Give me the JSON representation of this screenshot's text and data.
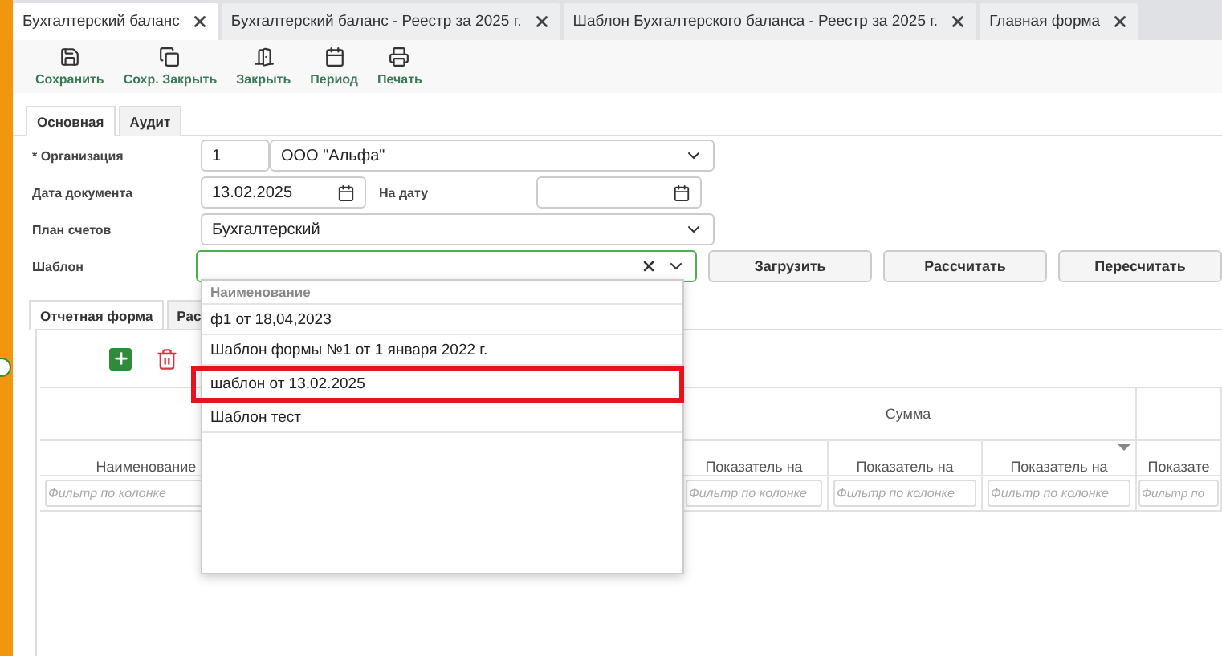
{
  "tabs": [
    {
      "label": "Бухгалтерский баланс",
      "selected": true
    },
    {
      "label": "Бухгалтерский баланс - Реестр за 2025 г.",
      "selected": false
    },
    {
      "label": "Шаблон Бухгалтерского баланса - Реестр за 2025 г.",
      "selected": false
    },
    {
      "label": "Главная форма",
      "selected": false
    }
  ],
  "toolbar": [
    {
      "kind": "save",
      "label": "Сохранить"
    },
    {
      "kind": "save_close",
      "label": "Сохр. Закрыть"
    },
    {
      "kind": "close",
      "label": "Закрыть"
    },
    {
      "kind": "period",
      "label": "Период"
    },
    {
      "kind": "print",
      "label": "Печать"
    }
  ],
  "form_tabs": [
    {
      "label": "Основная",
      "selected": true
    },
    {
      "label": "Аудит",
      "selected": false
    }
  ],
  "form": {
    "organization": {
      "label": "* Организация",
      "code": "1",
      "value": "ООО \"Альфа\""
    },
    "document_date": {
      "label": "Дата документа",
      "value": "13.02.2025"
    },
    "on_date": {
      "label": "На дату"
    },
    "chart_of_accounts": {
      "label": "План счетов",
      "value": "Бухгалтерский"
    },
    "template": {
      "label": "Шаблон",
      "focused": true
    }
  },
  "actions": [
    "Загрузить",
    "Рассчитать",
    "Пересчитать"
  ],
  "inner_tabs": [
    {
      "label": "Отчетная форма",
      "selected": true
    },
    {
      "label": "Рас",
      "selected": false
    }
  ],
  "grid": {
    "group_header": "Сумма",
    "columns": [
      {
        "label": "Наименование",
        "placeholder": "Фильтр по колонке",
        "has_menu": false
      },
      {
        "label": "Показатель на",
        "placeholder": "Фильтр по колонке",
        "has_menu": false
      },
      {
        "label": "Показатель на",
        "placeholder": "Фильтр по колонке",
        "has_menu": false
      },
      {
        "label": "Показатель на",
        "placeholder": "Фильтр по колонке",
        "has_menu": true
      },
      {
        "label": "Показате",
        "placeholder": "Фильтр по",
        "has_menu": false
      }
    ]
  },
  "dropdown": {
    "header": "Наименование",
    "items": [
      {
        "label": "ф1 от 18,04,2023",
        "marked": false
      },
      {
        "label": "Шаблон формы №1 от 1 января 2022 г.",
        "marked": false
      },
      {
        "label": "шаблон от 13.02.2025",
        "marked": true
      },
      {
        "label": "Шаблон тест",
        "marked": false
      }
    ]
  }
}
